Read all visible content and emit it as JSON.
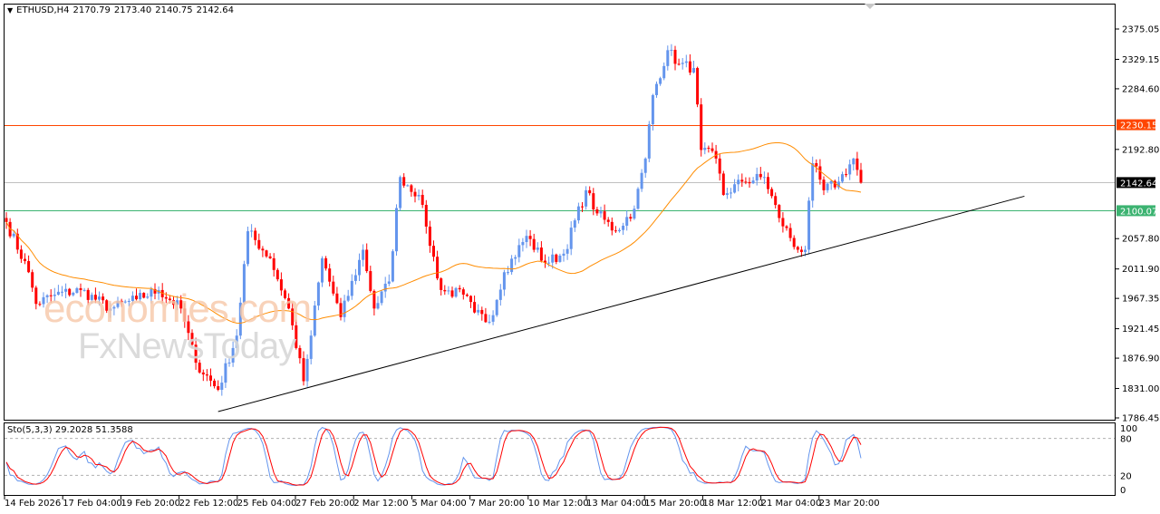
{
  "header": {
    "symbol": "ETHUSD,H4",
    "open": "2170.79",
    "high": "2173.40",
    "low": "2140.75",
    "close": "2142.64"
  },
  "watermark": {
    "line1": "economies.com",
    "line2": "FxNewsToday"
  },
  "colors": {
    "bull": "#6495ed",
    "bear": "#ff0000",
    "ma": "#ff8c00",
    "resistance": "#ff4500",
    "support": "#3cb371",
    "price_line": "#c0c0c0",
    "trend": "#000000",
    "sto_main": "#6495ed",
    "sto_signal": "#ff0000"
  },
  "chart_data": {
    "type": "candlestick",
    "title": "ETHUSD,H4",
    "ylim": [
      1786.45,
      2375.05
    ],
    "y_ticks": [
      "2375.05",
      "2329.15",
      "2284.60",
      "2192.80",
      "2057.80",
      "2011.90",
      "1967.35",
      "1921.45",
      "1876.90",
      "1831.00",
      "1786.45"
    ],
    "x_ticks": [
      "14 Feb 2026",
      "17 Feb 04:00",
      "19 Feb 20:00",
      "22 Feb 12:00",
      "25 Feb 04:00",
      "27 Feb 20:00",
      "2 Mar 12:00",
      "5 Mar 04:00",
      "7 Mar 20:00",
      "10 Mar 12:00",
      "13 Mar 04:00",
      "15 Mar 20:00",
      "18 Mar 12:00",
      "21 Mar 04:00",
      "23 Mar 20:00"
    ],
    "candle_count": 231,
    "close_keypoints": [
      [
        0,
        2083
      ],
      [
        6,
        2007
      ],
      [
        8,
        1959
      ],
      [
        13,
        1973
      ],
      [
        20,
        1980
      ],
      [
        28,
        1952
      ],
      [
        35,
        1966
      ],
      [
        41,
        1980
      ],
      [
        47,
        1952
      ],
      [
        51,
        1870
      ],
      [
        57,
        1829
      ],
      [
        62,
        1911
      ],
      [
        65,
        2069
      ],
      [
        71,
        2028
      ],
      [
        76,
        1952
      ],
      [
        80,
        1842
      ],
      [
        82,
        1911
      ],
      [
        85,
        2028
      ],
      [
        90,
        1939
      ],
      [
        96,
        2041
      ],
      [
        99,
        1952
      ],
      [
        103,
        1993
      ],
      [
        106,
        2151
      ],
      [
        111,
        2124
      ],
      [
        113,
        2076
      ],
      [
        117,
        1980
      ],
      [
        123,
        1973
      ],
      [
        126,
        1946
      ],
      [
        130,
        1932
      ],
      [
        134,
        2007
      ],
      [
        140,
        2062
      ],
      [
        145,
        2021
      ],
      [
        150,
        2035
      ],
      [
        156,
        2131
      ],
      [
        159,
        2096
      ],
      [
        164,
        2069
      ],
      [
        169,
        2103
      ],
      [
        172,
        2179
      ],
      [
        174,
        2275
      ],
      [
        178,
        2343
      ],
      [
        181,
        2322
      ],
      [
        185,
        2316
      ],
      [
        187,
        2192
      ],
      [
        191,
        2179
      ],
      [
        193,
        2124
      ],
      [
        198,
        2144
      ],
      [
        204,
        2151
      ],
      [
        208,
        2089
      ],
      [
        213,
        2041
      ],
      [
        215,
        2041
      ],
      [
        217,
        2172
      ],
      [
        220,
        2131
      ],
      [
        224,
        2144
      ],
      [
        228,
        2179
      ],
      [
        230,
        2142.64
      ]
    ],
    "moving_average": {
      "period": 40
    },
    "horizontal_levels": [
      {
        "label": "2230.15",
        "price": 2230.15,
        "kind": "resistance"
      },
      {
        "label": "2142.64",
        "price": 2142.64,
        "kind": "current"
      },
      {
        "label": "2100.07",
        "price": 2100.07,
        "kind": "support"
      }
    ],
    "trendline": {
      "from": [
        57,
        1796
      ],
      "to": [
        274,
        2122
      ]
    },
    "stochastic": {
      "label": "Sto(5,3,3)",
      "main": "29.2028",
      "signal": "51.3588",
      "levels": [
        "100",
        "80",
        "20",
        "0"
      ]
    }
  }
}
